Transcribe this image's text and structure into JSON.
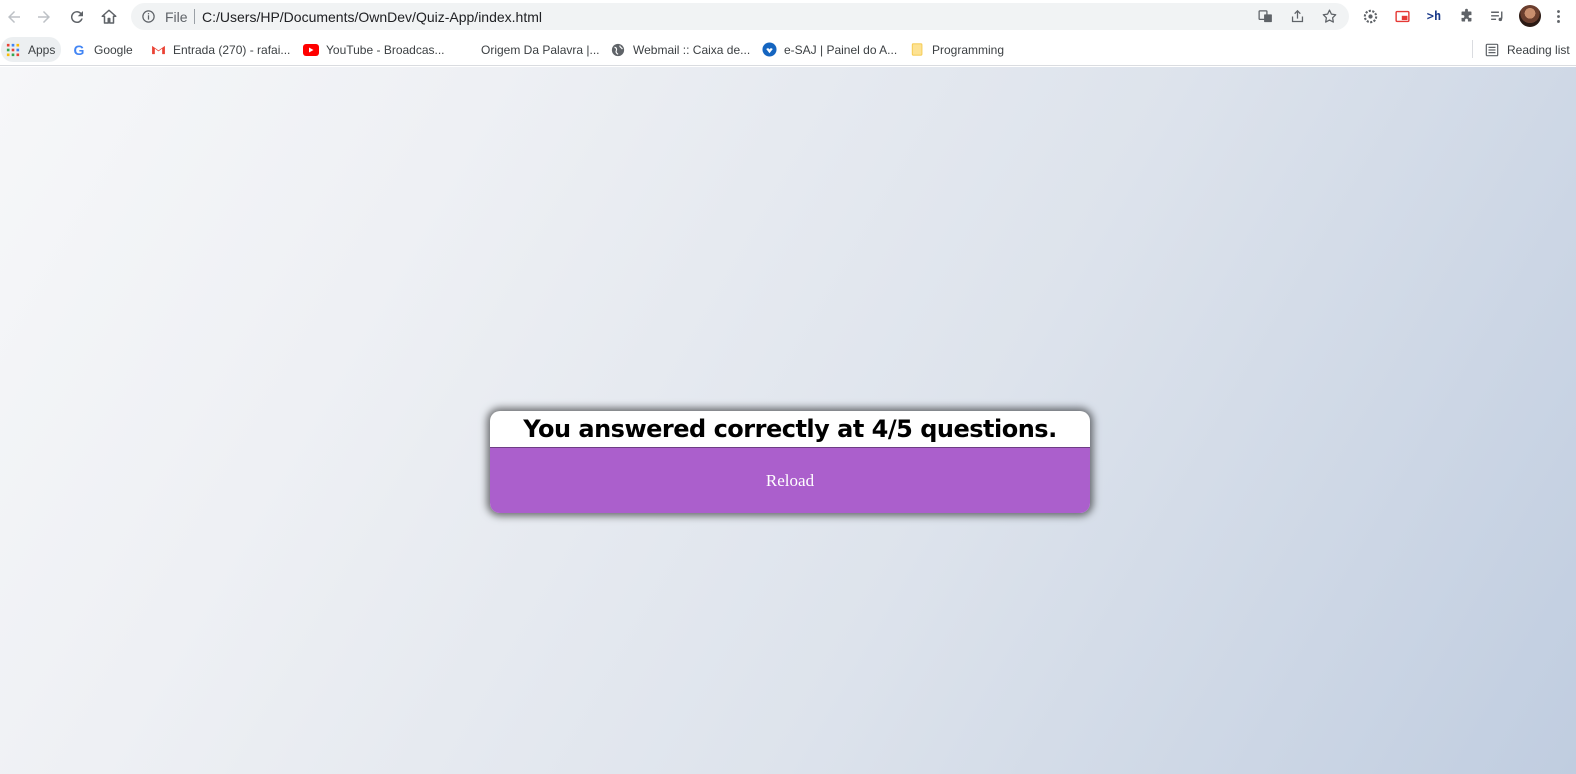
{
  "browser": {
    "omnibox": {
      "scheme_label": "File",
      "url": "C:/Users/HP/Documents/OwnDev/Quiz-App/index.html"
    },
    "bookmarks": [
      {
        "label": "Apps",
        "icon": "apps-grid-icon"
      },
      {
        "label": "Google",
        "icon": "google-icon"
      },
      {
        "label": "Entrada (270) - rafai...",
        "icon": "gmail-icon"
      },
      {
        "label": "YouTube - Broadcas...",
        "icon": "youtube-icon"
      },
      {
        "label": "Origem Da Palavra |...",
        "icon": ""
      },
      {
        "label": "Webmail :: Caixa de...",
        "icon": "globe-icon"
      },
      {
        "label": "e-SAJ | Painel do A...",
        "icon": "esaj-icon"
      },
      {
        "label": "Programming",
        "icon": "folder-icon"
      }
    ],
    "reading_list": "Reading list"
  },
  "quiz": {
    "result_text": "You answered correctly at 4/5 questions.",
    "reload_label": "Reload",
    "accent_color": "#ab5fcc"
  }
}
